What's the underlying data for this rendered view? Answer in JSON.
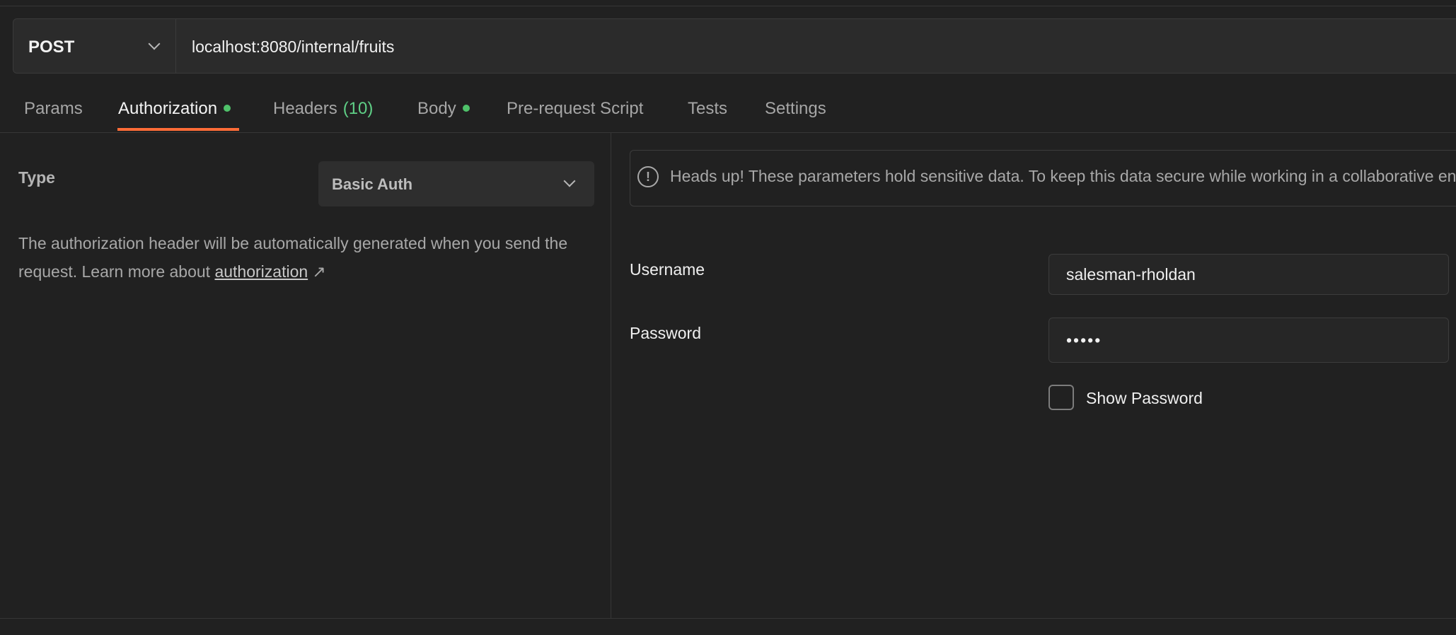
{
  "request": {
    "method": "POST",
    "url": "localhost:8080/internal/fruits"
  },
  "tabs": [
    {
      "label": "Params"
    },
    {
      "label": "Authorization"
    },
    {
      "label": "Headers",
      "count": "(10)"
    },
    {
      "label": "Body"
    },
    {
      "label": "Pre-request Script"
    },
    {
      "label": "Tests"
    },
    {
      "label": "Settings"
    }
  ],
  "active_tab": "Authorization",
  "auth": {
    "type_label": "Type",
    "type_value": "Basic Auth",
    "description": "The authorization header will be automatically generated when you send the request. Learn more about",
    "link_text": "authorization",
    "link_arrow": "↗"
  },
  "notice": {
    "icon": "info-icon",
    "text": "Heads up! These parameters hold sensitive data. To keep this data secure while working in a collaborative environment, we recommend using variables."
  },
  "fields": {
    "username_label": "Username",
    "username_value": "salesman-rholdan",
    "password_label": "Password",
    "password_value": "•••••",
    "show_password_label": "Show Password"
  },
  "colors": {
    "accent": "#ff6c37",
    "indicator": "#4fc26a",
    "background": "#212121"
  }
}
